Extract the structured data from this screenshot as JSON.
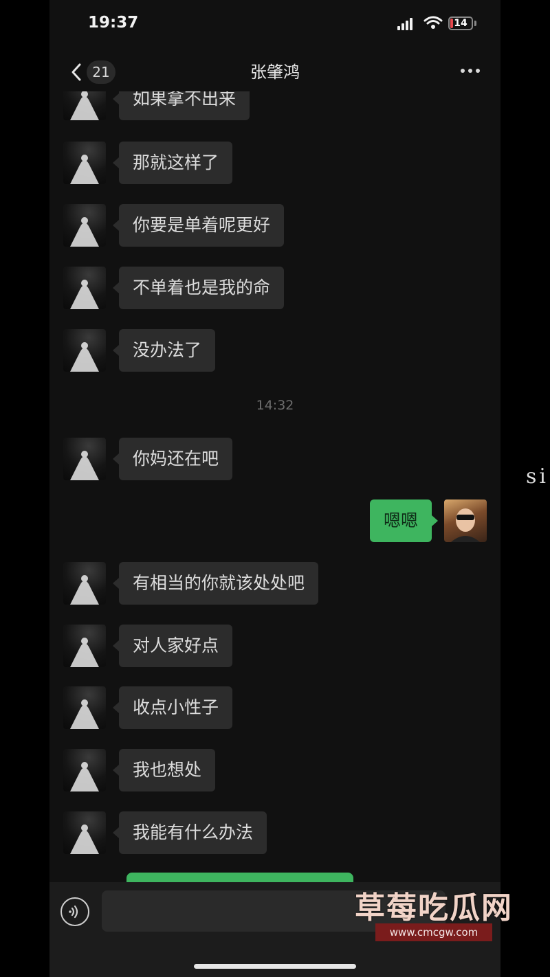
{
  "status_bar": {
    "time": "19:37",
    "battery": "14",
    "battery_level": 0.14,
    "battery_color": "#e5484d"
  },
  "nav": {
    "unread": "21",
    "title": "张肇鸿"
  },
  "messages": [
    {
      "side": "in",
      "text": "如果拿不出来"
    },
    {
      "side": "in",
      "text": "那就这样了"
    },
    {
      "side": "in",
      "text": "你要是单着呢更好"
    },
    {
      "side": "in",
      "text": "不单着也是我的命"
    },
    {
      "side": "in",
      "text": "没办法了"
    },
    {
      "type": "time",
      "text": "14:32"
    },
    {
      "side": "in",
      "text": "你妈还在吧"
    },
    {
      "side": "out",
      "text": "嗯嗯"
    },
    {
      "side": "in",
      "text": "有相当的你就该处处吧"
    },
    {
      "side": "in",
      "text": "对人家好点"
    },
    {
      "side": "in",
      "text": "收点小性子"
    },
    {
      "side": "in",
      "text": "我也想处"
    },
    {
      "side": "in",
      "text": "我能有什么办法"
    }
  ],
  "input": {
    "placeholder": ""
  },
  "watermark": {
    "title": "草莓吃瓜网",
    "url": "www.cmcgw.com"
  },
  "edge_text": "si",
  "colors": {
    "outgoing_bubble": "#3eb55f",
    "incoming_bubble": "#2c2c2c",
    "background": "#111111"
  }
}
